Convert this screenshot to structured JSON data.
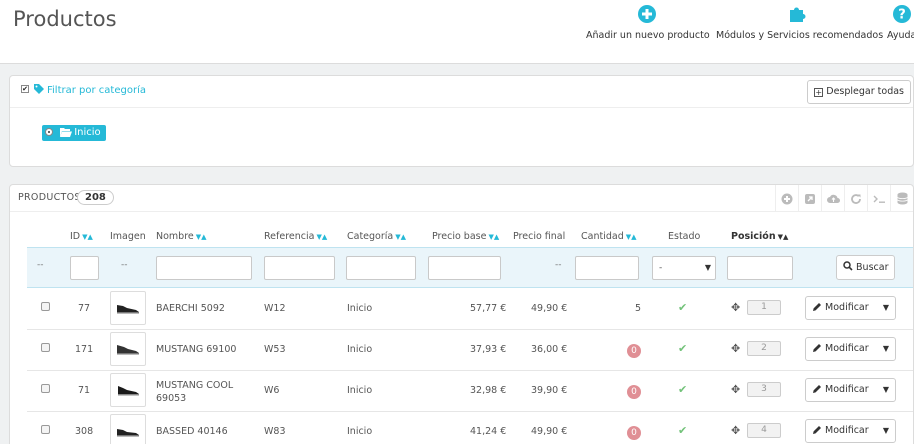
{
  "header": {
    "title": "Productos",
    "actions": {
      "add_product": "Añadir un nuevo producto",
      "modules": "Módulos y Servicios recomendados",
      "help": "Ayuda"
    }
  },
  "category_filter": {
    "title": "Filtrar por categoría",
    "expand_label": "Desplegar todas",
    "root_label": "Inicio"
  },
  "products": {
    "title": "PRODUCTOS",
    "count": "208",
    "columns": {
      "id": "ID",
      "image": "Imagen",
      "name": "Nombre",
      "reference": "Referencia",
      "category": "Categoría",
      "base_price": "Precio base",
      "final_price": "Precio final",
      "quantity": "Cantidad",
      "status": "Estado",
      "position": "Posición"
    },
    "filters": {
      "dash": "--",
      "status_value": "-",
      "search_label": "Buscar"
    },
    "rows": [
      {
        "id": "77",
        "name": "BAERCHI 5092",
        "reference": "W12",
        "category": "Inicio",
        "base_price": "57,77 €",
        "final_price": "49,90 €",
        "quantity": "5",
        "position": "1",
        "edit": "Modificar"
      },
      {
        "id": "171",
        "name": "MUSTANG 69100",
        "reference": "W53",
        "category": "Inicio",
        "base_price": "37,93 €",
        "final_price": "36,00 €",
        "quantity": "0",
        "position": "2",
        "edit": "Modificar"
      },
      {
        "id": "71",
        "name": "MUSTANG COOL 69053",
        "reference": "W6",
        "category": "Inicio",
        "base_price": "32,98 €",
        "final_price": "39,90 €",
        "quantity": "0",
        "position": "3",
        "edit": "Modificar"
      },
      {
        "id": "308",
        "name": "BASSED 40146",
        "reference": "W83",
        "category": "Inicio",
        "base_price": "41,24 €",
        "final_price": "49,90 €",
        "quantity": "0",
        "position": "4",
        "edit": "Modificar"
      }
    ]
  },
  "colors": {
    "accent": "#25b9d7",
    "success": "#72c279",
    "danger_badge": "#e08f95"
  }
}
